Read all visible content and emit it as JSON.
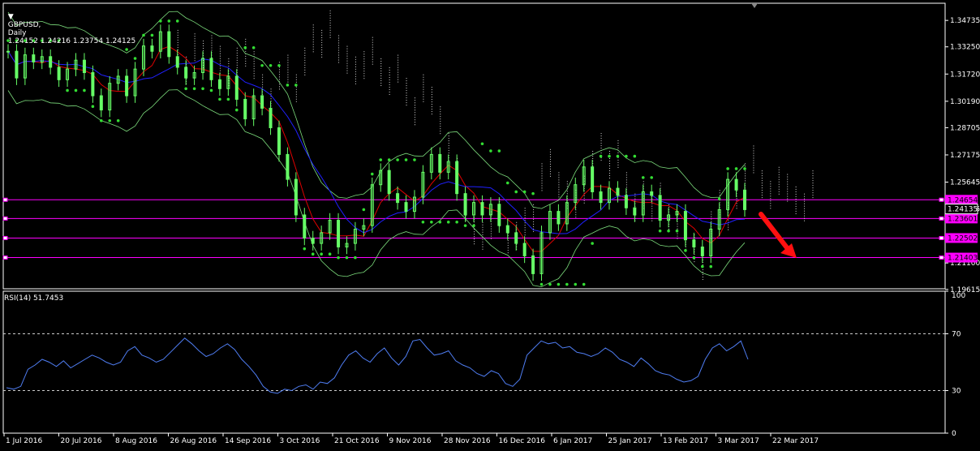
{
  "header": {
    "symbol": "GBPUSD",
    "timeframe": "Daily",
    "ohlc": "1.24152 1.24216 1.23754 1.24125"
  },
  "rsi_header": {
    "label": "RSI(14) 51.7453"
  },
  "colors": {
    "bg": "#000000",
    "axis": "#ffffff",
    "candle": "#66ff66",
    "rsi": "#4f7df2",
    "hline": "#ff00ff",
    "bb": "#7cdc7c",
    "sar": "#33dd33",
    "ma_red": "#e00000",
    "ma_blue": "#2020ff",
    "cloud": "#ffffff",
    "arrow": "#ff1010"
  },
  "chart_data": [
    {
      "type": "line",
      "title": "GBPUSD, Daily",
      "ylim": [
        1.1965,
        1.357
      ],
      "y_ticks": [
        "1.34735",
        "1.33250",
        "1.31720",
        "1.30190",
        "1.28705",
        "1.27175",
        "1.25645",
        "1.24135",
        "1.21100",
        "1.19615"
      ],
      "x_ticks": [
        "1 Jul 2016",
        "20 Jul 2016",
        "8 Aug 2016",
        "26 Aug 2016",
        "14 Sep 2016",
        "3 Oct 2016",
        "21 Oct 2016",
        "9 Nov 2016",
        "28 Nov 2016",
        "16 Dec 2016",
        "6 Jan 2017",
        "25 Jan 2017",
        "13 Feb 2017",
        "3 Mar 2017",
        "22 Mar 2017"
      ],
      "levels": [
        "1.24654",
        "1.23601",
        "1.22502",
        "1.21403"
      ],
      "price_label": "1.24135",
      "series": [
        {
          "values": [
            1.33,
            1.315,
            1.328,
            1.324,
            1.327,
            1.321,
            1.314,
            1.32,
            1.325,
            1.318,
            1.305,
            1.297,
            1.312,
            1.316,
            1.305,
            1.32,
            1.333,
            1.33,
            1.341,
            1.327,
            1.321,
            1.315,
            1.318,
            1.326,
            1.314,
            1.309,
            1.316,
            1.303,
            1.292,
            1.305,
            1.298,
            1.287,
            1.272,
            1.258,
            1.238,
            1.225,
            1.222,
            1.228,
            1.235,
            1.22,
            1.222,
            1.23,
            1.232,
            1.255,
            1.263,
            1.25,
            1.245,
            1.24,
            1.248,
            1.262,
            1.272,
            1.262,
            1.268,
            1.25,
            1.238,
            1.245,
            1.238,
            1.244,
            1.232,
            1.228,
            1.222,
            1.215,
            1.205,
            1.228,
            1.24,
            1.233,
            1.245,
            1.255,
            1.265,
            1.251,
            1.245,
            1.253,
            1.249,
            1.242,
            1.238,
            1.251,
            1.249,
            1.235,
            1.238,
            1.24,
            1.224,
            1.22,
            1.215,
            1.23,
            1.241,
            1.258,
            1.252,
            1.241
          ]
        }
      ]
    },
    {
      "type": "line",
      "title": "RSI(14)",
      "ylim": [
        0,
        100
      ],
      "y_ticks": [
        "100",
        "70",
        "30",
        "0"
      ],
      "levels": [
        70,
        30
      ],
      "series": [
        {
          "values": [
            32,
            31,
            33,
            45,
            48,
            52,
            50,
            47,
            51,
            46,
            49,
            52,
            55,
            53,
            50,
            48,
            50,
            58,
            61,
            55,
            53,
            50,
            52,
            57,
            62,
            67,
            63,
            58,
            54,
            56,
            60,
            63,
            59,
            52,
            47,
            41,
            33,
            29,
            28,
            31,
            30,
            33,
            34,
            31,
            36,
            35,
            39,
            48,
            55,
            58,
            53,
            50,
            56,
            60,
            53,
            48,
            54,
            65,
            66,
            60,
            55,
            56,
            58,
            51,
            48,
            46,
            42,
            40,
            44,
            42,
            35,
            33,
            38,
            55,
            60,
            65,
            63,
            64,
            60,
            61,
            57,
            56,
            54,
            56,
            60,
            57,
            52,
            50,
            47,
            53,
            49,
            44,
            42,
            41,
            38,
            36,
            37,
            40,
            52,
            60,
            63,
            58,
            61,
            65,
            52
          ]
        }
      ]
    }
  ]
}
